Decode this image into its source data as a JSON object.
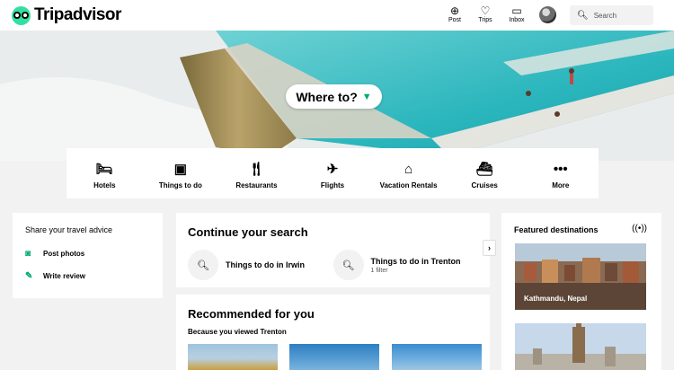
{
  "header": {
    "logo_text": "Tripadvisor",
    "nav": [
      {
        "label": "Post",
        "icon": "plus-circle-icon"
      },
      {
        "label": "Trips",
        "icon": "heart-icon"
      },
      {
        "label": "Inbox",
        "icon": "message-icon"
      }
    ],
    "search": {
      "placeholder": "Search"
    }
  },
  "hero": {
    "where_label": "Where to?"
  },
  "categories": [
    {
      "label": "Hotels",
      "icon": "bed-icon"
    },
    {
      "label": "Things to do",
      "icon": "ticket-icon"
    },
    {
      "label": "Restaurants",
      "icon": "cutlery-icon"
    },
    {
      "label": "Flights",
      "icon": "plane-icon"
    },
    {
      "label": "Vacation Rentals",
      "icon": "house-icon"
    },
    {
      "label": "Cruises",
      "icon": "ship-icon"
    },
    {
      "label": "More",
      "icon": "ellipsis-icon"
    }
  ],
  "share": {
    "title": "Share your travel advice",
    "post_photos": "Post photos",
    "write_review": "Write review"
  },
  "continue": {
    "title": "Continue your search",
    "items": [
      {
        "title": "Things to do in Irwin",
        "sub": ""
      },
      {
        "title": "Things to do in Trenton",
        "sub": "1 filter"
      }
    ]
  },
  "recommended": {
    "title": "Recommended for you",
    "subtitle": "Because you viewed Trenton"
  },
  "featured": {
    "title": "Featured destinations",
    "destinations": [
      {
        "name": "Kathmandu, Nepal"
      }
    ]
  },
  "colors": {
    "brand": "#34e0a1",
    "accent_green": "#00aa6c",
    "page_bg": "#f2f2f2"
  }
}
